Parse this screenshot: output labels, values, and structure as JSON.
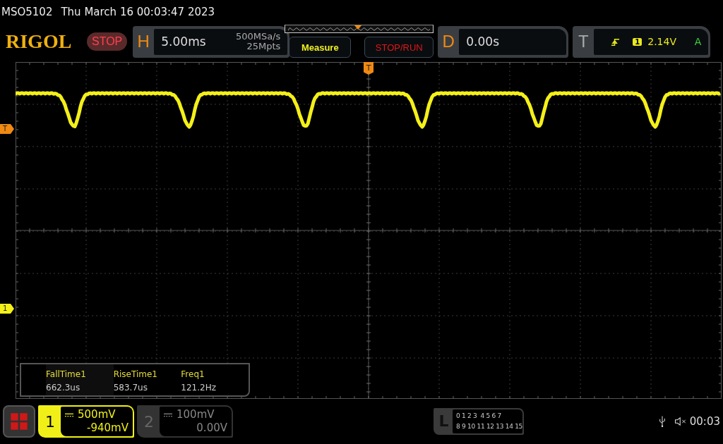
{
  "title_bar": {
    "model": "MSO5102",
    "datetime": "Thu March 16 00:03:47 2023"
  },
  "logo": "RIGOL",
  "run_status": {
    "label": "STOP",
    "kind": "stop"
  },
  "horizontal": {
    "label": "H",
    "timebase": "5.00ms",
    "sample_rate": "500MSa/s",
    "memory_depth": "25Mpts"
  },
  "memory_bar": {
    "level": 0.49
  },
  "buttons": [
    {
      "label": "Measure",
      "kind": "measure"
    },
    {
      "label": "STOP/RUN",
      "kind": "stoprun"
    }
  ],
  "delay": {
    "label": "D",
    "value": "0.00s"
  },
  "trigger": {
    "label": "T",
    "source": "1",
    "level": "2.14V",
    "mode": "A"
  },
  "markers": {
    "trigger_position": "T",
    "trigger_level": "T",
    "channel": "1"
  },
  "measurements": [
    {
      "name": "FallTime1",
      "value": "662.3us"
    },
    {
      "name": "RiseTime1",
      "value": "583.7us"
    },
    {
      "name": "Freq1",
      "value": "121.2Hz"
    }
  ],
  "channels": [
    {
      "number": "1",
      "scale": "500mV",
      "offset": "-940mV",
      "selected": true
    },
    {
      "number": "2",
      "scale": "100mV",
      "offset": "0.00V",
      "selected": false
    }
  ],
  "logic": {
    "label": "L",
    "row_1": "0 1 2 3  4 5 6 7",
    "row_2": "8 9 10 11 12 13 14 15"
  },
  "status": {
    "time": "00:03"
  }
}
